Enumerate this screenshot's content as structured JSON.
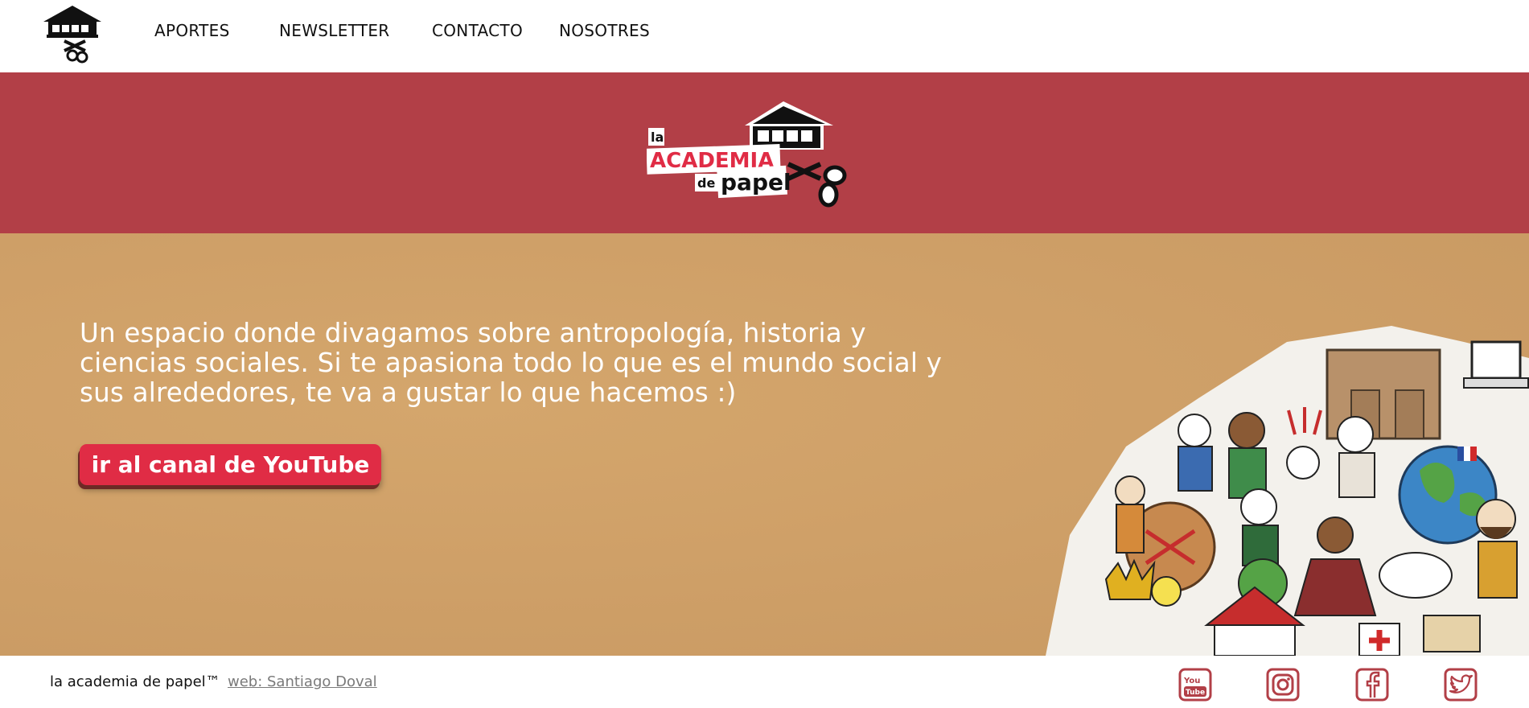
{
  "nav": {
    "logo_icon": "academia-house-scissors-logo-icon",
    "items": [
      {
        "label": "APORTES"
      },
      {
        "label": "NEWSLETTER"
      },
      {
        "label": "CONTACTO"
      },
      {
        "label": "NOSOTRES"
      }
    ]
  },
  "banner": {
    "logo": {
      "word1": "la",
      "word2": "ACADEMIA",
      "word3": "de",
      "word4": "papel"
    },
    "background_color": "#b23f47"
  },
  "hero": {
    "text": "Un espacio donde divagamos sobre antropología, historia y ciencias sociales. Si te apasiona todo lo que es el mundo social y sus alrededores, te va a gustar lo que hacemos :)",
    "button_label": "ir al canal de YouTube",
    "button_color": "#e02c45",
    "background_color": "#cfa068",
    "illustration": "paper-cutout-collage"
  },
  "footer": {
    "brand": "la academia de papel™",
    "credit": "web: Santiago Doval",
    "social": [
      {
        "name": "youtube-icon",
        "label": "You Tube"
      },
      {
        "name": "instagram-icon"
      },
      {
        "name": "facebook-icon"
      },
      {
        "name": "twitter-icon"
      }
    ],
    "social_color": "#b23f47"
  }
}
